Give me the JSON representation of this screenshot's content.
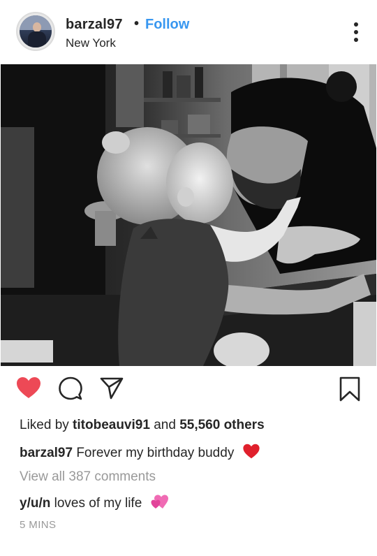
{
  "post": {
    "username": "barzal97",
    "separator": "•",
    "follow_label": "Follow",
    "location": "New York",
    "likes": {
      "prefix": "Liked by ",
      "first_liker": "titobeauvi91",
      "middle": " and ",
      "others": "55,560 others"
    },
    "caption": {
      "username": "barzal97",
      "text": " Forever my birthday buddy"
    },
    "view_all_comments": "View all 387 comments",
    "comment": {
      "username": "y/u/n",
      "text": " loves of my life"
    },
    "timestamp": "5 MINS"
  },
  "colors": {
    "accent": "#3897f0",
    "like_active": "#ed4956",
    "muted_text": "#999999",
    "text": "#262626"
  },
  "icons": {
    "avatar": "profile-photo",
    "more": "more-vertical-icon",
    "like": "heart-filled-icon",
    "comment": "comment-bubble-icon",
    "share": "paper-plane-icon",
    "save": "bookmark-icon",
    "caption_emoji": "red-heart-emoji",
    "comment_emoji": "two-hearts-emoji"
  }
}
